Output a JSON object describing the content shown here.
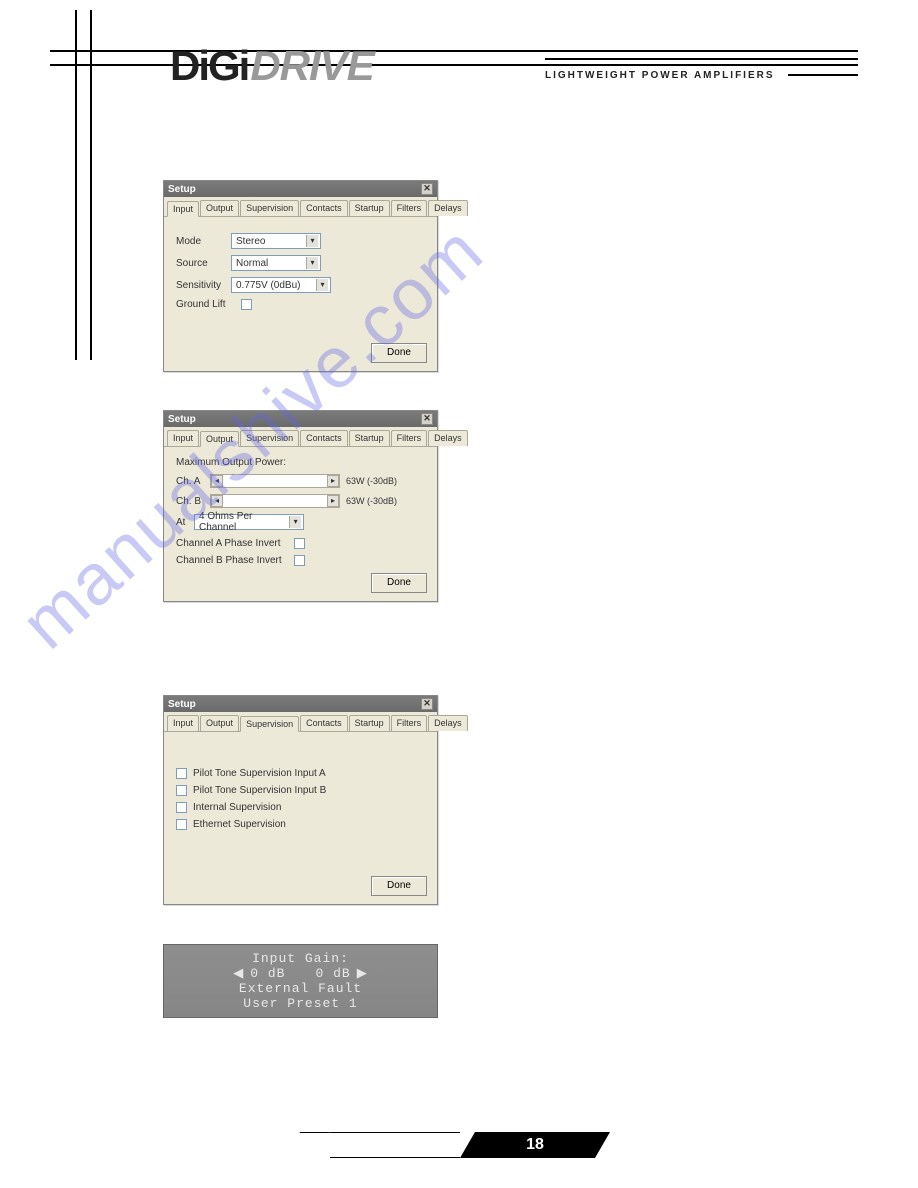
{
  "header": {
    "logo_part1": "DiGi",
    "logo_part2": "DRIVE",
    "tagline": "LIGHTWEIGHT POWER AMPLIFIERS"
  },
  "dialog_common": {
    "title": "Setup",
    "close_glyph": "✕",
    "done_label": "Done",
    "tabs": [
      "Input",
      "Output",
      "Supervision",
      "Contacts",
      "Startup",
      "Filters",
      "Delays"
    ]
  },
  "dialog1": {
    "active_tab_index": 0,
    "fields": {
      "mode_label": "Mode",
      "mode_value": "Stereo",
      "source_label": "Source",
      "source_value": "Normal",
      "sensitivity_label": "Sensitivity",
      "sensitivity_value": "0.775V (0dBu)",
      "groundlift_label": "Ground Lift"
    }
  },
  "dialog2": {
    "active_tab_index": 1,
    "heading": "Maximum Output Power:",
    "ch_a_label": "Ch. A",
    "ch_a_value": "63W (-30dB)",
    "ch_b_label": "Ch. B",
    "ch_b_value": "63W (-30dB)",
    "at_label": "At",
    "at_value": "4 Ohms Per Channel",
    "phase_a_label": "Channel A Phase Invert",
    "phase_b_label": "Channel B Phase Invert"
  },
  "dialog3": {
    "active_tab_index": 2,
    "opt1": "Pilot Tone Supervision Input A",
    "opt2": "Pilot Tone Supervision Input B",
    "opt3": "Internal Supervision",
    "opt4": "Ethernet Supervision"
  },
  "lcd": {
    "line1": "Input Gain:",
    "line2_left": "0  dB",
    "line2_right": "0  dB",
    "line3": "External Fault",
    "line4": "User Preset 1"
  },
  "footer": {
    "page_number": "18"
  },
  "watermark": "manualshive.com"
}
